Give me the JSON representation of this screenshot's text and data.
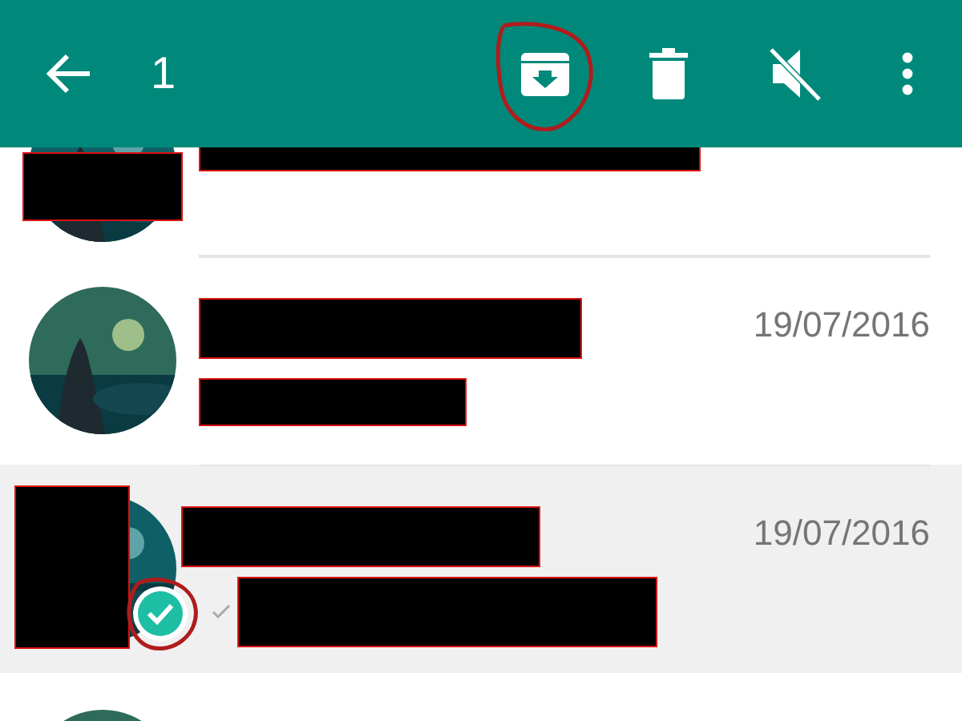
{
  "toolbar": {
    "selection_count": "1",
    "actions": [
      {
        "kind": "archive",
        "annotated": true
      },
      {
        "kind": "delete",
        "annotated": false
      },
      {
        "kind": "mute",
        "annotated": false
      },
      {
        "kind": "more",
        "annotated": false
      }
    ]
  },
  "chats": [
    {
      "avatar_redacted": true,
      "name_redacted": true,
      "message_redacted": false,
      "selected": false,
      "annotated": false
    },
    {
      "avatar_redacted": false,
      "name_redacted": true,
      "message_redacted": true,
      "date": "19/07/2016",
      "selected": false,
      "annotated": false
    },
    {
      "avatar_redacted": true,
      "name_redacted": true,
      "message_redacted": true,
      "date": "19/07/2016",
      "selected": true,
      "annotated": true,
      "read_ticks": true
    },
    {
      "avatar_redacted": false,
      "name_redacted": false,
      "message_redacted": false,
      "selected": false,
      "annotated": false
    }
  ]
}
